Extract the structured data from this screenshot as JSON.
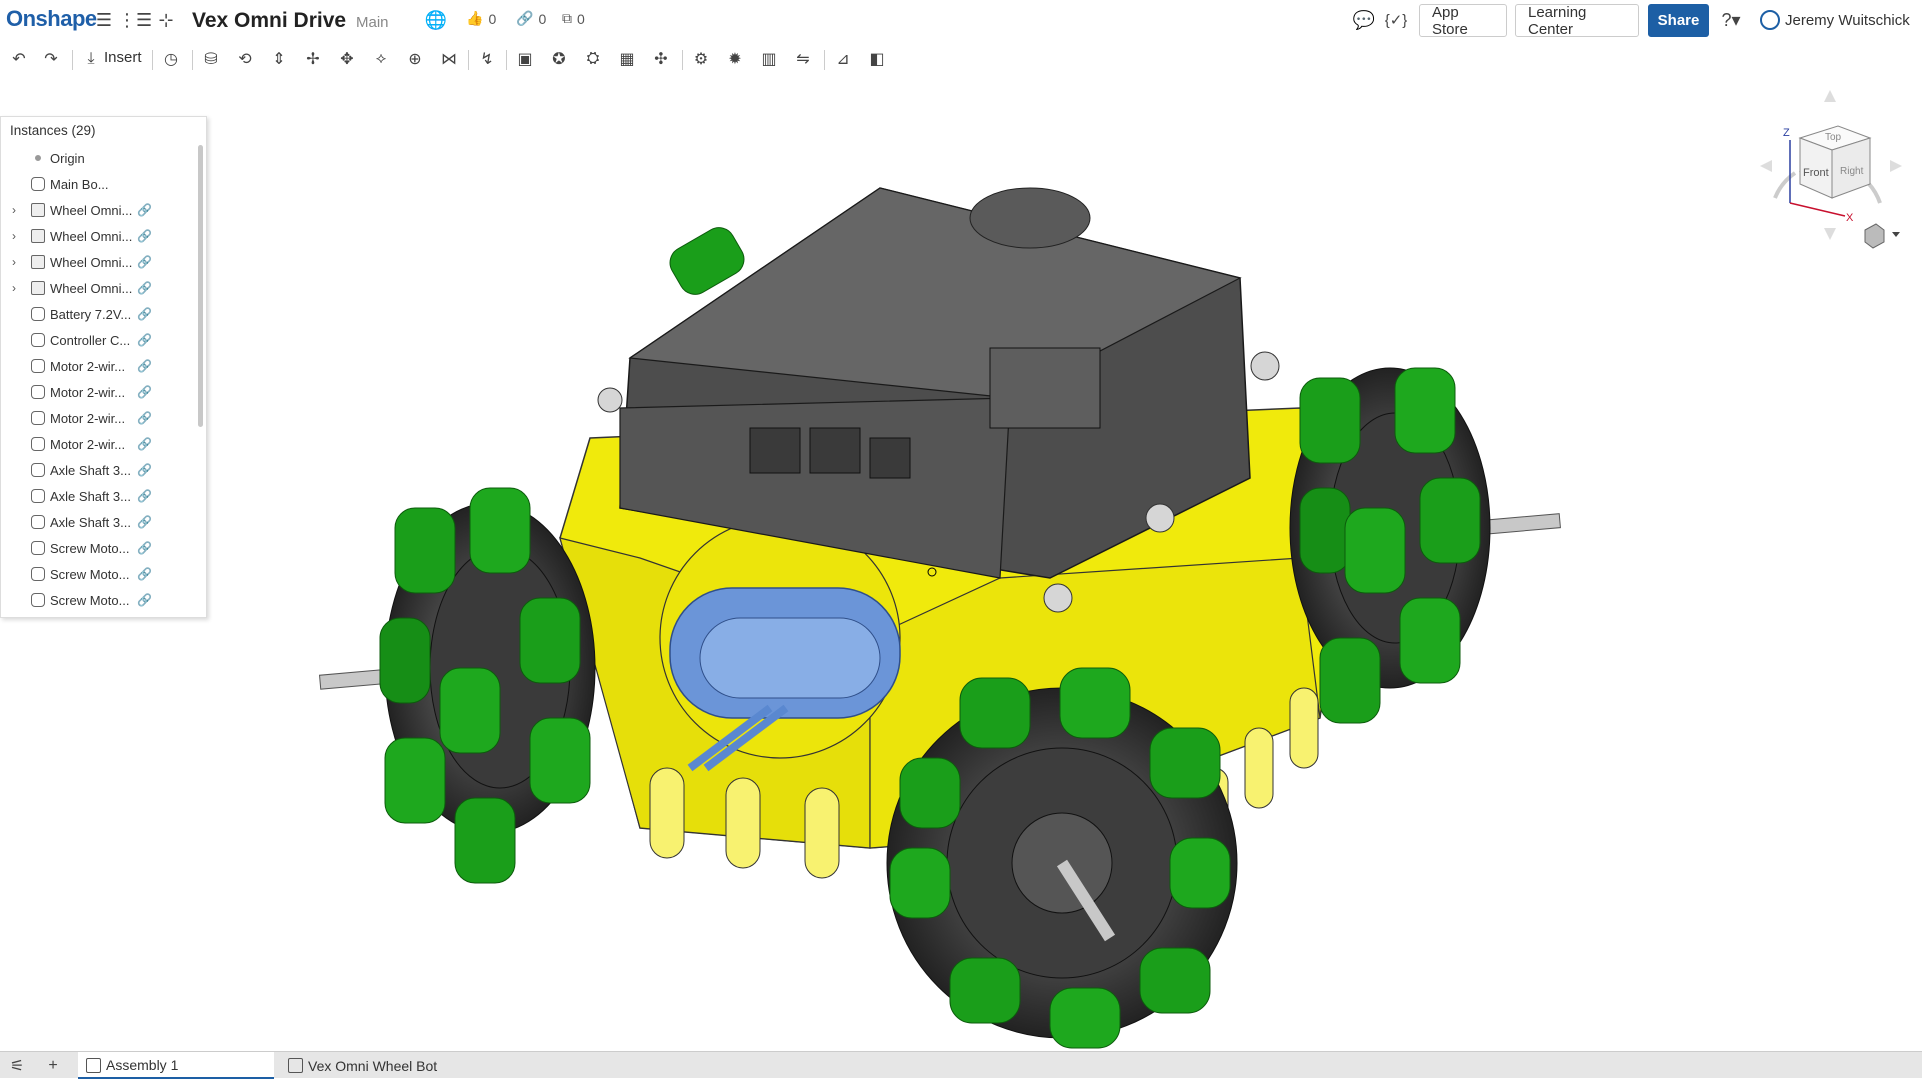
{
  "header": {
    "logo": "Onshape",
    "doc_title": "Vex Omni Drive",
    "branch": "Main",
    "likes": "0",
    "links": "0",
    "copies": "0",
    "app_store": "App Store",
    "learning_center": "Learning Center",
    "share": "Share",
    "user_name": "Jeremy Wuitschick"
  },
  "toolbar": {
    "insert_label": "Insert"
  },
  "instances": {
    "title": "Instances (29)",
    "items": [
      {
        "label": "Origin",
        "type": "origin",
        "expandable": false,
        "linked": false
      },
      {
        "label": "Main Bo...",
        "type": "part",
        "expandable": false,
        "linked": false
      },
      {
        "label": "Wheel Omni...",
        "type": "assembly",
        "expandable": true,
        "linked": true
      },
      {
        "label": "Wheel Omni...",
        "type": "assembly",
        "expandable": true,
        "linked": true
      },
      {
        "label": "Wheel Omni...",
        "type": "assembly",
        "expandable": true,
        "linked": true
      },
      {
        "label": "Wheel Omni...",
        "type": "assembly",
        "expandable": true,
        "linked": true
      },
      {
        "label": "Battery 7.2V...",
        "type": "part",
        "expandable": false,
        "linked": true
      },
      {
        "label": "Controller C...",
        "type": "part",
        "expandable": false,
        "linked": true
      },
      {
        "label": "Motor 2-wir...",
        "type": "part",
        "expandable": false,
        "linked": true
      },
      {
        "label": "Motor 2-wir...",
        "type": "part",
        "expandable": false,
        "linked": true
      },
      {
        "label": "Motor 2-wir...",
        "type": "part",
        "expandable": false,
        "linked": true
      },
      {
        "label": "Motor 2-wir...",
        "type": "part",
        "expandable": false,
        "linked": true
      },
      {
        "label": "Axle Shaft 3...",
        "type": "part",
        "expandable": false,
        "linked": true
      },
      {
        "label": "Axle Shaft 3...",
        "type": "part",
        "expandable": false,
        "linked": true
      },
      {
        "label": "Axle Shaft 3...",
        "type": "part",
        "expandable": false,
        "linked": true
      },
      {
        "label": "Screw Moto...",
        "type": "part",
        "expandable": false,
        "linked": true
      },
      {
        "label": "Screw Moto...",
        "type": "part",
        "expandable": false,
        "linked": true
      },
      {
        "label": "Screw Moto...",
        "type": "part",
        "expandable": false,
        "linked": true
      }
    ]
  },
  "viewcube": {
    "top": "Top",
    "front": "Front",
    "right": "Right",
    "axis_z": "Z",
    "axis_x": "X"
  },
  "tabs": [
    {
      "label": "Assembly 1",
      "active": true
    },
    {
      "label": "Vex Omni Wheel Bot",
      "active": false
    }
  ],
  "colors": {
    "brand": "#1f5fa8",
    "chassis_yellow": "#f0ea0c",
    "wheel_green": "#1a9e1a",
    "controller_grey": "#5a5a5a",
    "battery_blue": "#6b95d8"
  }
}
